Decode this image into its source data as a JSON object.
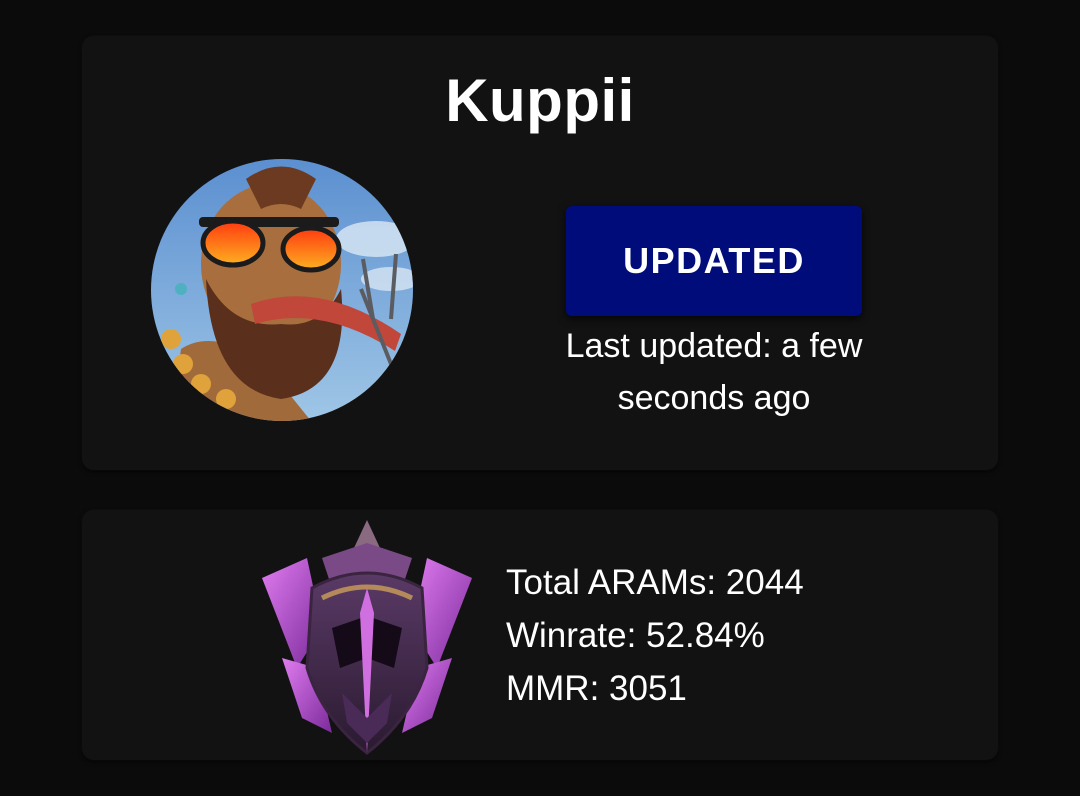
{
  "profile": {
    "name": "Kuppii",
    "avatar_icon": "champion-avatar-icon",
    "update_button_label": "UPDATED",
    "last_updated_text": "Last updated: a few seconds ago"
  },
  "stats": {
    "rank_icon": "master-rank-emblem-icon",
    "total_arams": "Total ARAMs: 2044",
    "winrate": "Winrate: 52.84%",
    "mmr": "MMR: 3051"
  },
  "colors": {
    "background": "#0b0b0c",
    "card": "#121213",
    "button": "#000c7a",
    "text": "#ffffff"
  }
}
